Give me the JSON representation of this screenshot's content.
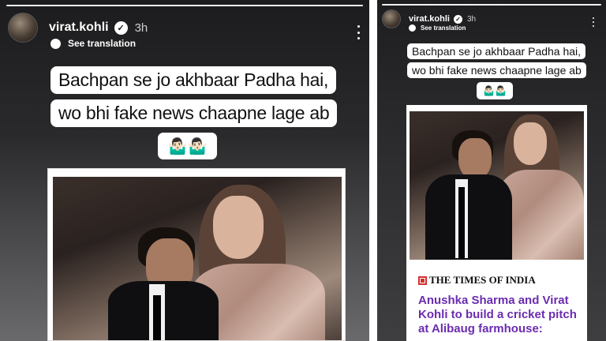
{
  "left_story": {
    "user": {
      "username": "virat.kohli",
      "time": "3h"
    },
    "see_translation": "See translation",
    "caption": {
      "line1": "Bachpan se jo akhbaar Padha hai,",
      "line2": "wo bhi fake news chaapne lage ab",
      "emojis": "🤷🏻‍♂️🤷🏻‍♂️"
    },
    "progress": 1.0
  },
  "right_story": {
    "user": {
      "username": "virat.kohli",
      "time": "3h"
    },
    "see_translation": "See translation",
    "caption": {
      "line1": "Bachpan se jo akhbaar Padha hai,",
      "line2": "wo bhi fake news chaapne lage ab",
      "emojis": "🤷🏻‍♂️🤷🏻‍♂️"
    },
    "news": {
      "publisher": "THE TIMES OF INDIA",
      "headline": "Anushka Sharma and Virat Kohli to build a cricket pitch at Alibaug farmhouse:"
    },
    "progress": 1.0
  },
  "colors": {
    "headline": "#6a2cb0",
    "toi_logo": "#d32f2f"
  },
  "icons": {
    "verified": "verified-badge-icon",
    "translate": "translate-icon",
    "more": "more-options-icon"
  }
}
